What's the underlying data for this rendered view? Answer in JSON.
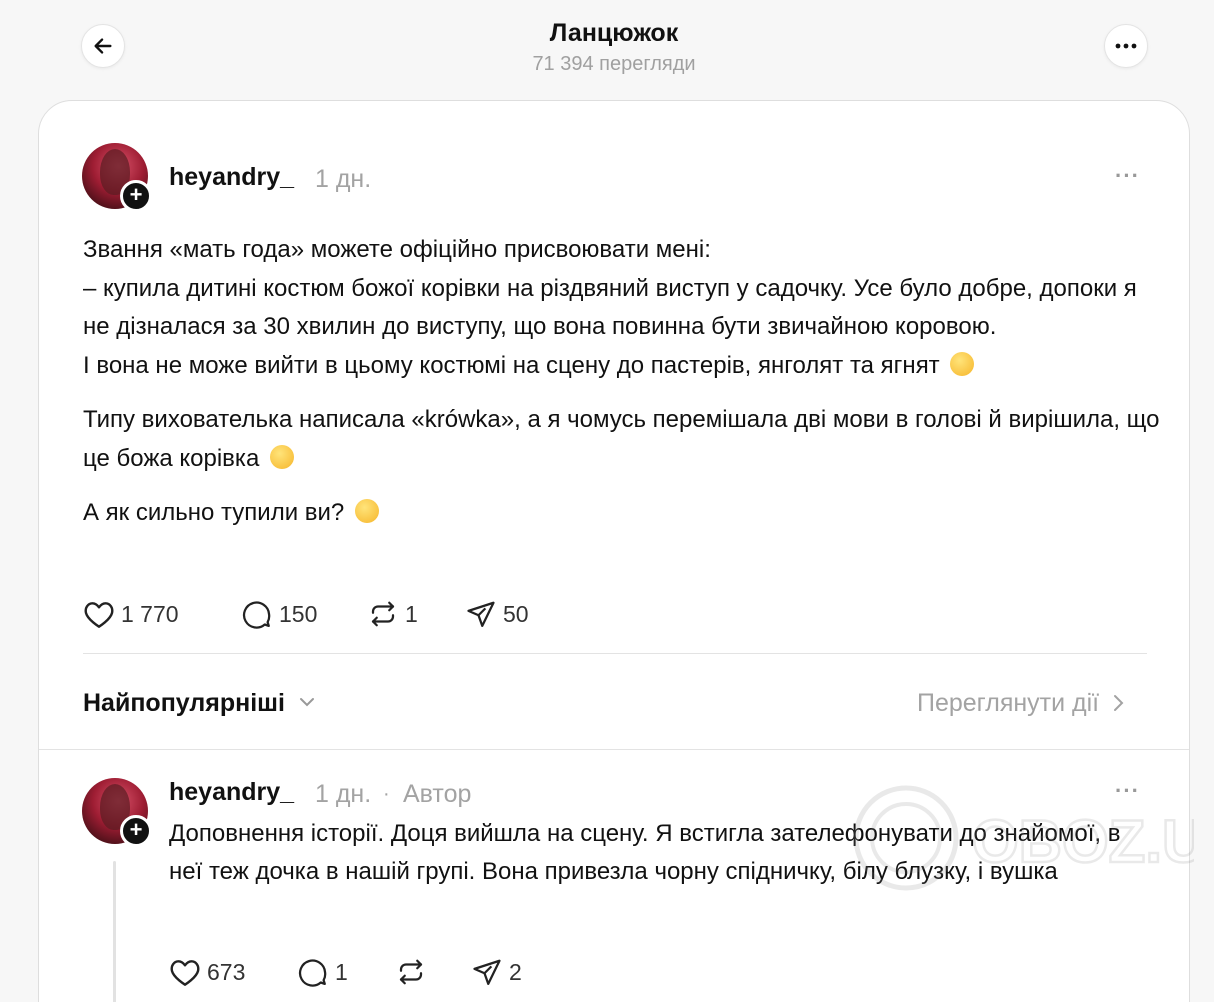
{
  "header": {
    "title": "Ланцюжок",
    "views": "71 394 перегляди"
  },
  "post": {
    "username": "heyandry_",
    "time": "1 дн.",
    "paragraphs": [
      "Звання «мать года» можете офіційно присвоювати мені:",
      "– купила дитині костюм божої корівки на різдвяний виступ у садочку. Усе було добре, допоки я не дізналася за 30 хвилин до виступу, що вона повинна бути звичайною коровою.",
      "І вона не може вийти в цьому костюмі на сцену до пастерів, янголят та ягнят",
      "Типу вихователька написала «krówka», а я чомусь перемішала дві мови в голові й вирішила, що це божа корівка",
      "А як сильно тупили ви?"
    ],
    "emojis": [
      "melting-face-emoji",
      "shushing-face-emoji",
      "grinning-sweat-emoji"
    ],
    "likes": "1 770",
    "comments": "150",
    "reposts": "1",
    "shares": "50"
  },
  "sort": {
    "label": "Найпопулярніші",
    "view_activity": "Переглянути дії"
  },
  "reply": {
    "username": "heyandry_",
    "time": "1 дн.",
    "separator": "·",
    "role": "Автор",
    "text": "Доповнення історії. Доця вийшла на сцену. Я встигла зателефонувати до знайомої, в неї теж дочка в нашій групі. Вона привезла чорну спідничку, білу блузку, і вушка",
    "likes": "673",
    "comments": "1",
    "shares": "2"
  },
  "watermark": "OBOZ.UA",
  "colors": {
    "background": "#f7f7f7",
    "card": "#ffffff",
    "muted_text": "#a3a3a3",
    "primary_text": "#111111"
  }
}
